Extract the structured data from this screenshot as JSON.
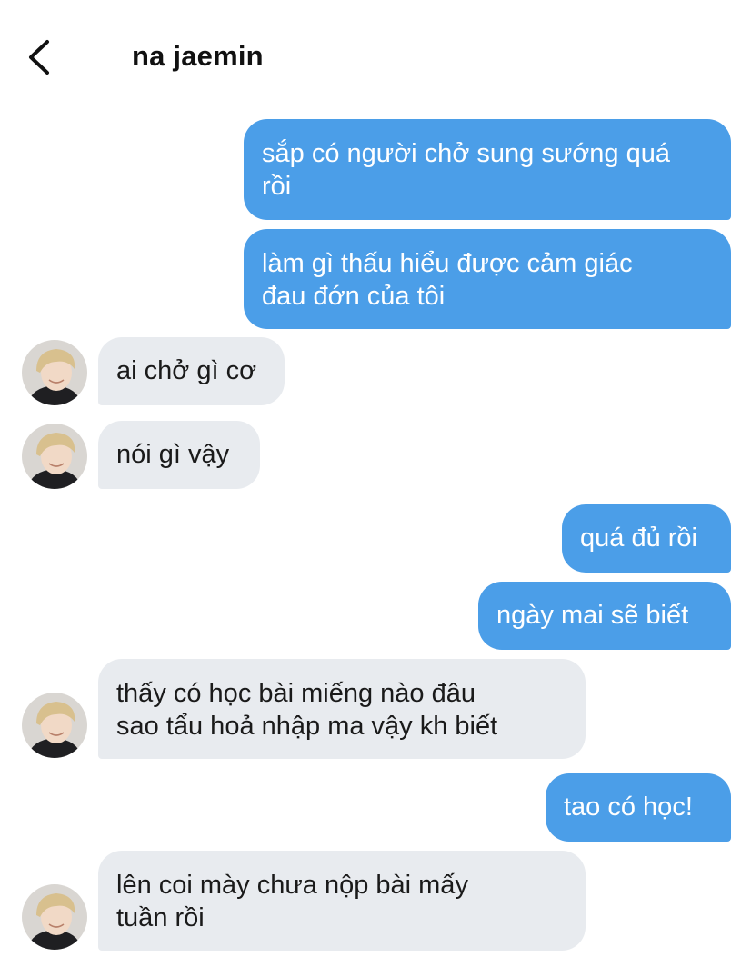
{
  "header": {
    "back_icon": "chevron-left-icon",
    "contact_name": "na jaemin"
  },
  "messages": [
    {
      "direction": "sent",
      "text": "sắp có người chở sung sướng quá\nrồi"
    },
    {
      "direction": "sent",
      "text": "làm gì thấu hiểu được cảm giác\nđau đớn của tôi"
    },
    {
      "direction": "received",
      "text": "ai chở gì cơ"
    },
    {
      "direction": "received",
      "text": "nói gì vậy"
    },
    {
      "direction": "sent",
      "text": "quá đủ rồi"
    },
    {
      "direction": "sent",
      "text": "ngày mai sẽ biết"
    },
    {
      "direction": "received",
      "text": "thấy có học bài miếng nào đâu\nsao tẩu hoả nhập ma vậy kh biết"
    },
    {
      "direction": "sent",
      "text": "tao có học!"
    },
    {
      "direction": "received",
      "text": "lên coi mày chưa nộp bài mấy\ntuần rồi"
    }
  ],
  "colors": {
    "sent_bubble": "#4b9ee8",
    "received_bubble": "#e8ebef",
    "sent_text": "#ffffff",
    "received_text": "#1a1a1a"
  }
}
